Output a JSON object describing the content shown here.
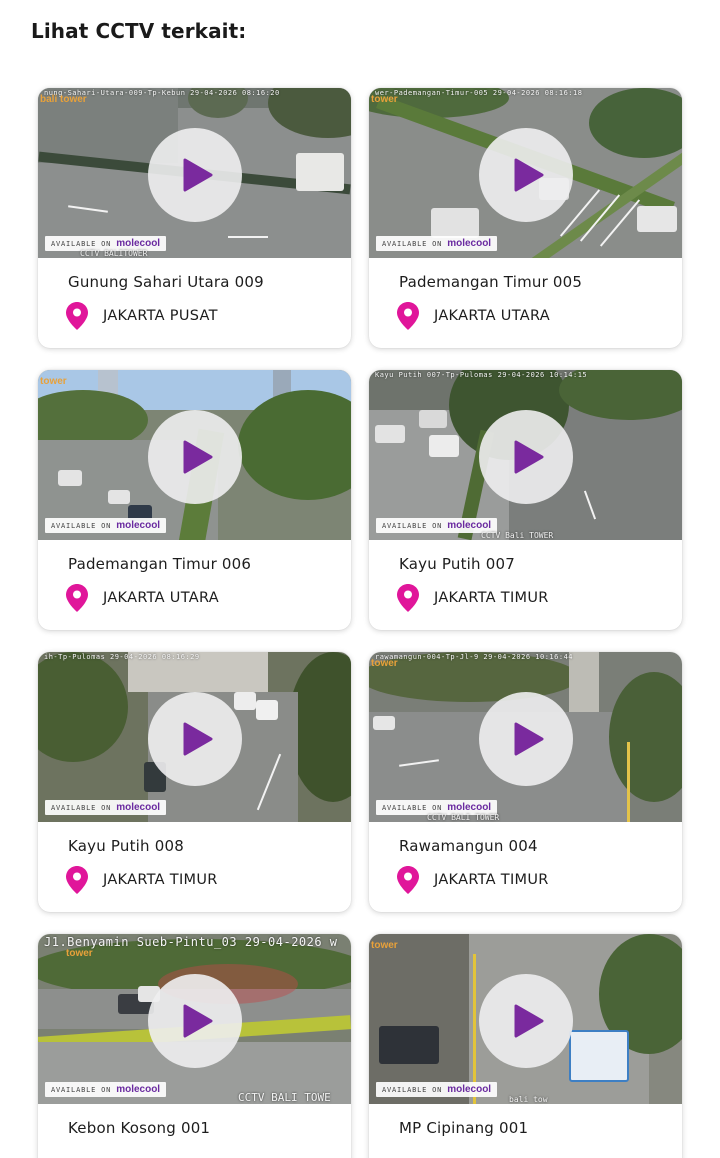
{
  "heading": "Lihat CCTV terkait:",
  "accent_color": "#e0169a",
  "play_icon_color": "#7a2a9e",
  "available_text": "AVAILABLE ON",
  "available_brand": "molecool",
  "cards": [
    {
      "name": "Gunung Sahari Utara 009",
      "city": "JAKARTA PUSAT",
      "stamp": "nung-Sahari-Utara-009-Tp-Kebun 29-04-2026 08:16:20",
      "brand": "bali tower",
      "tag": "CCTV BALITOWER"
    },
    {
      "name": "Pademangan Timur 005",
      "city": "JAKARTA UTARA",
      "stamp": "wer-Pademangan-Timur-005 29-04-2026 08:16:18",
      "brand": "tower",
      "tag": ""
    },
    {
      "name": "Pademangan Timur 006",
      "city": "JAKARTA UTARA",
      "stamp": "",
      "brand": "tower",
      "tag": ""
    },
    {
      "name": "Kayu Putih 007",
      "city": "JAKARTA TIMUR",
      "stamp": "Kayu Putih 007-Tp-Pulomas 29-04-2026 10:14:15",
      "brand": "",
      "tag": "CCTV Bali TOWER"
    },
    {
      "name": "Kayu Putih 008",
      "city": "JAKARTA TIMUR",
      "stamp": "ih-Tp-Pulomas 29-04-2026 08:16:29",
      "brand": "",
      "tag": ""
    },
    {
      "name": "Rawamangun 004",
      "city": "JAKARTA TIMUR",
      "stamp": "rawamangun-004-Tp-Jl-9 29-04-2026 10:16:44",
      "brand": "tower",
      "tag": "CCTV BALI TOWER"
    },
    {
      "name": "Kebon Kosong 001",
      "city": "",
      "stamp": "J1.Benyamin Sueb-Pintu_03   29-04-2026 w",
      "brand": "tower",
      "tag": "CCTV BALI TOWE"
    },
    {
      "name": "MP Cipinang 001",
      "city": "",
      "stamp": "",
      "brand": "tower",
      "tag": "bali tow"
    }
  ]
}
